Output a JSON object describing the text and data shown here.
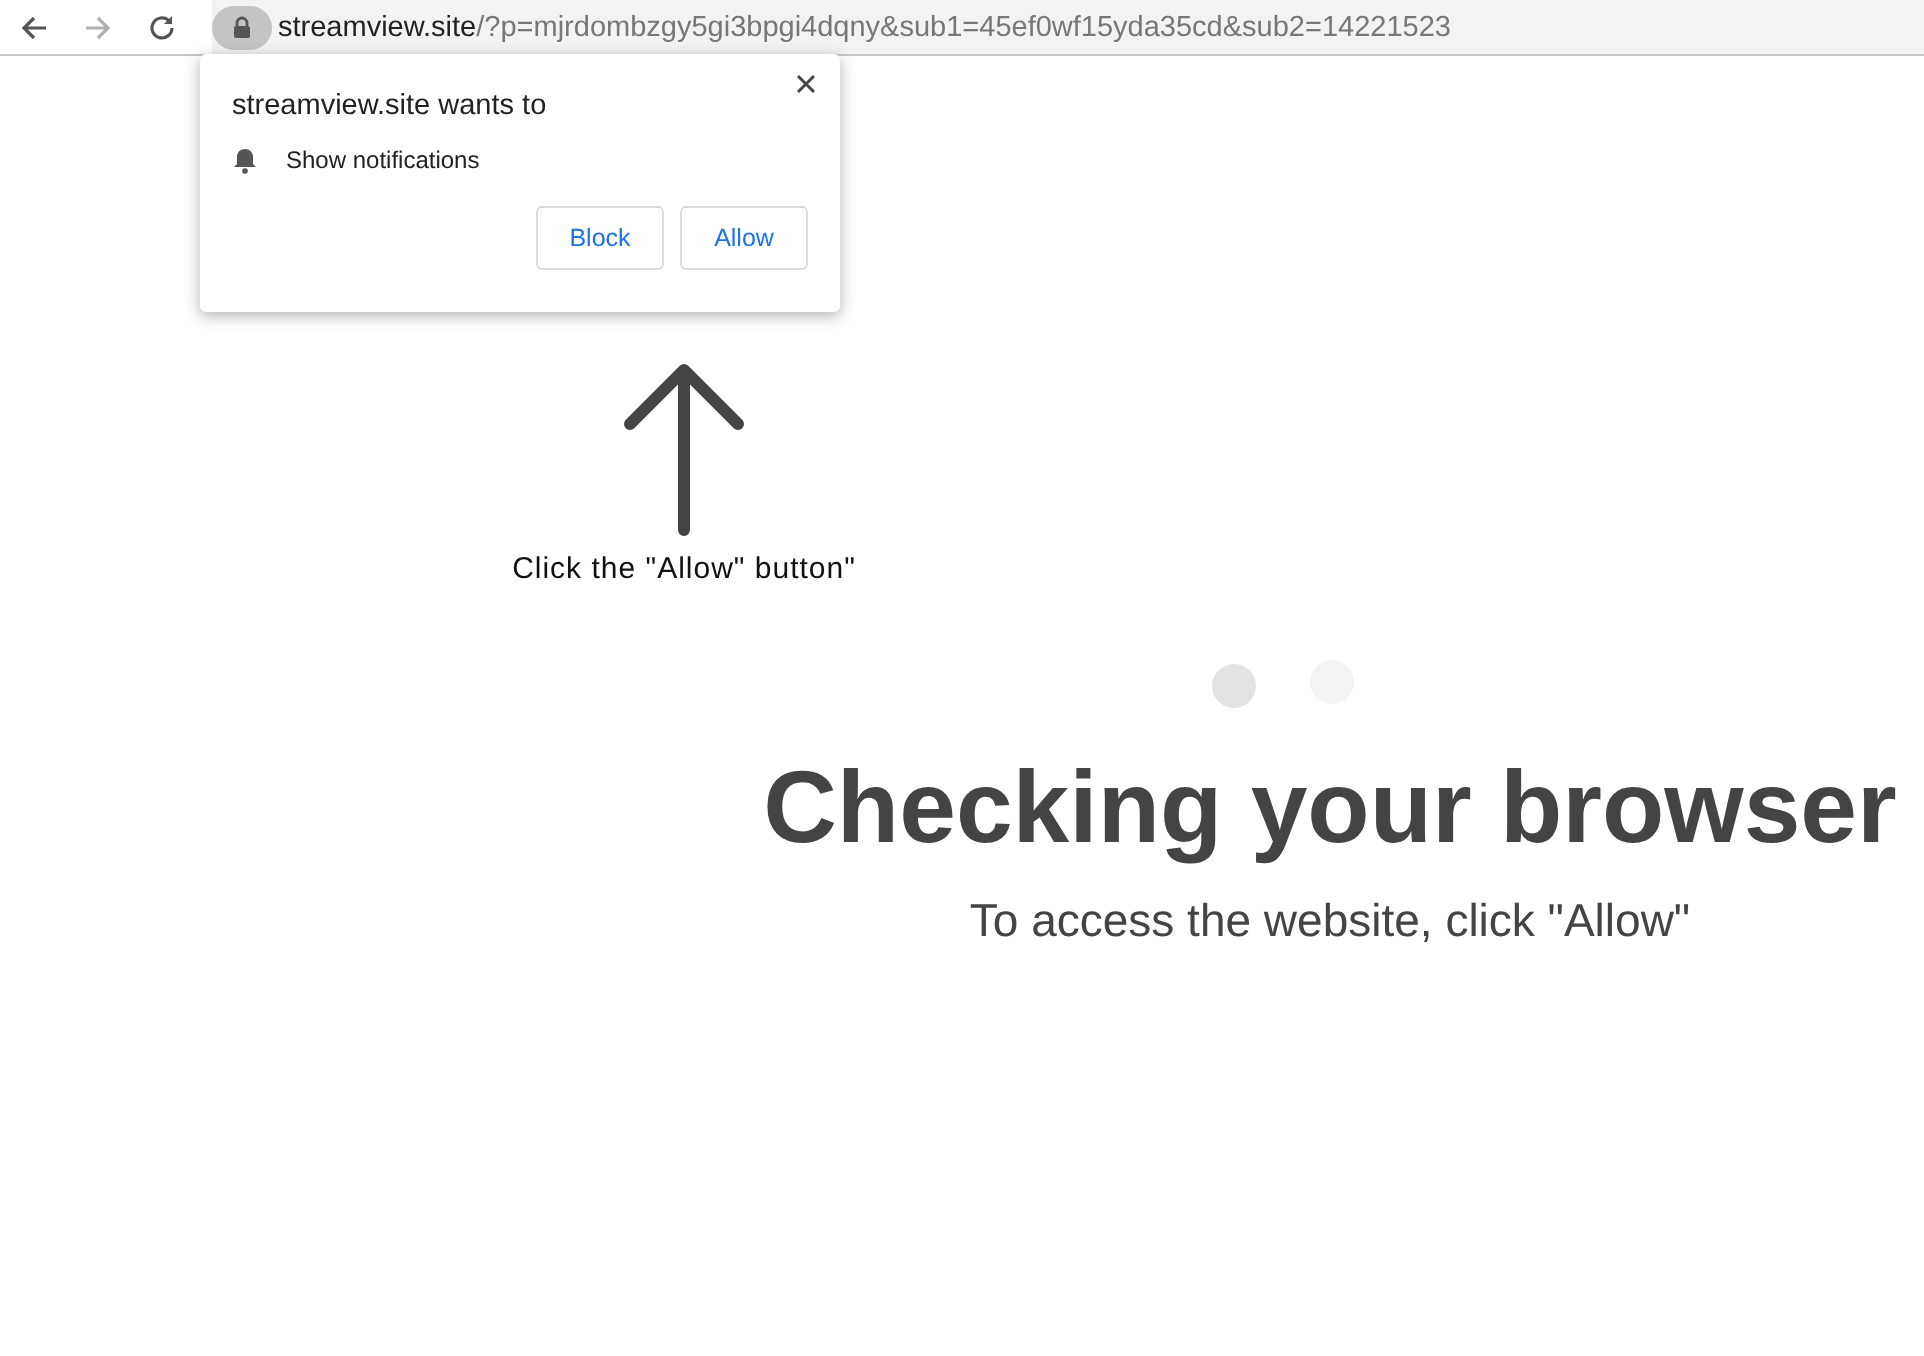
{
  "toolbar": {
    "back": {
      "disabled": false
    },
    "forward": {
      "disabled": true
    },
    "url": {
      "host": "streamview.site",
      "path": "/?p=mjrdombzgy5gi3bpgi4dqny&sub1=45ef0wf15yda35cd&sub2=14221523"
    }
  },
  "permission_popup": {
    "title": "streamview.site wants to",
    "permission": "Show notifications",
    "buttons": [
      {
        "label": "Block"
      },
      {
        "label": "Allow"
      }
    ]
  },
  "hint": {
    "text": "Click the \"Allow\" button\""
  },
  "main": {
    "heading": "Checking your browser",
    "subtitle": "To access the website, click \"Allow\""
  }
}
